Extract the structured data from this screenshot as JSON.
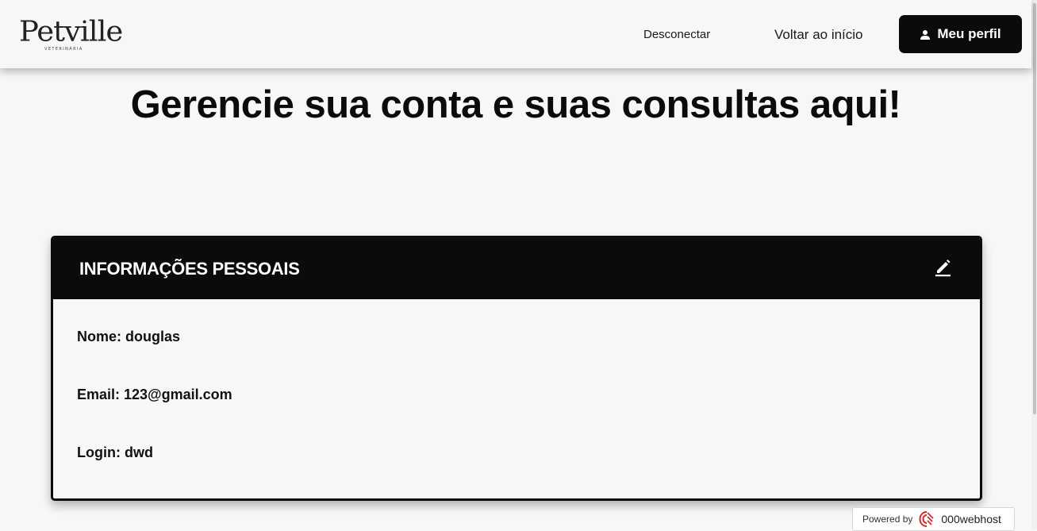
{
  "header": {
    "logo_text": "Petville",
    "logo_subtitle": "VETERINÁRIA",
    "nav": {
      "disconnect": "Desconectar",
      "home": "Voltar ao início",
      "profile": "Meu perfil"
    }
  },
  "main": {
    "title": "Gerencie sua conta e suas consultas aqui!"
  },
  "card": {
    "title": "INFORMAÇÕES PESSOAIS",
    "name_line": "Nome: douglas",
    "email_line": "Email: 123@gmail.com",
    "login_line": "Login: dwd"
  },
  "footer": {
    "powered_by": "Powered by",
    "brand": "000webhost"
  },
  "icons": {
    "profile": "user-icon",
    "edit": "pencil-icon",
    "brand": "000webhost-logo-icon"
  },
  "colors": {
    "background": "#f7f7f7",
    "primary": "#0b0b0b",
    "brand_red": "#d6272e"
  }
}
